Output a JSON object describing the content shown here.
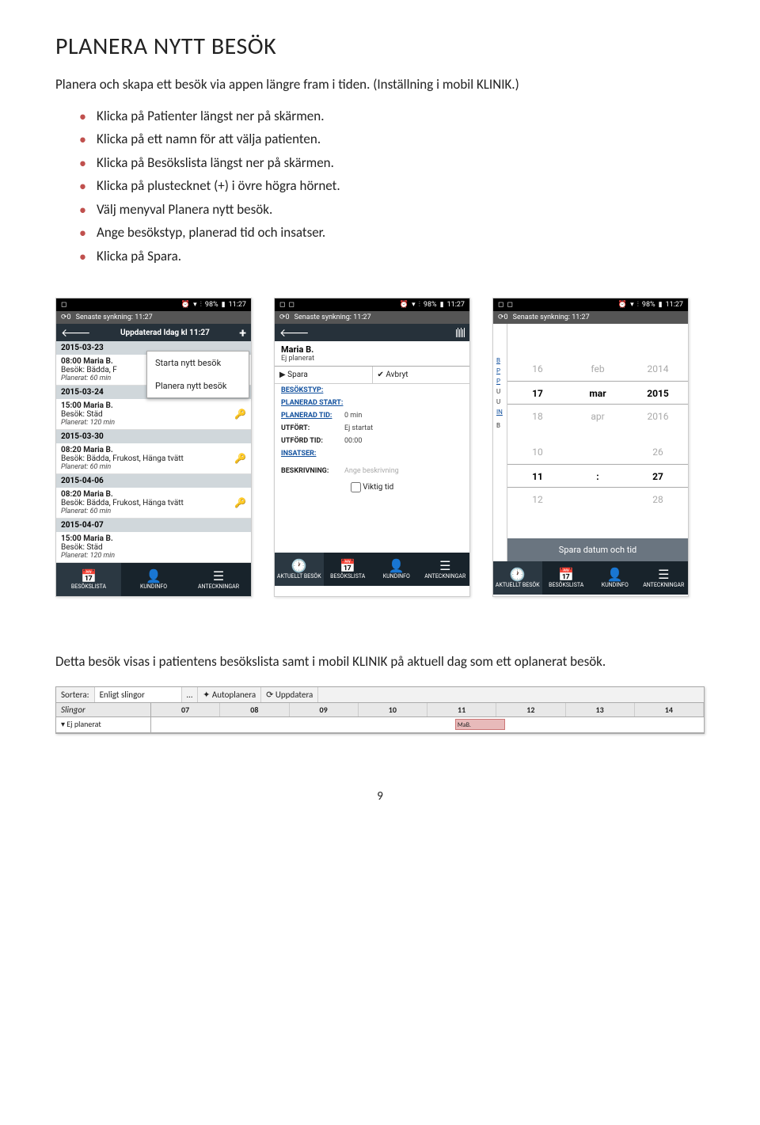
{
  "doc": {
    "heading": "PLANERA NYTT BESÖK",
    "intro": "Planera och skapa ett besök via appen längre fram i tiden. (Inställning i mobil KLINIK.)",
    "steps": [
      "Klicka på Patienter längst ner på skärmen.",
      "Klicka på ett namn för att välja patienten.",
      "Klicka på Besökslista längst ner på skärmen.",
      "Klicka på plustecknet (+) i övre högra hörnet.",
      "Välj menyval Planera nytt besök.",
      "Ange besökstyp, planerad tid och insatser.",
      "Klicka på Spara."
    ],
    "after": "Detta besök visas i patientens besökslista samt i mobil KLINIK på aktuell dag som ett oplanerat besök.",
    "pagenum": "9"
  },
  "status": {
    "battery": "98%",
    "time": "11:27"
  },
  "sync": {
    "count": "0",
    "label": "Senaste synkning: 11:27"
  },
  "phone1": {
    "topbar_title": "Uppdaterad Idag kl 11:27",
    "popup": [
      "Starta nytt besök",
      "Planera nytt besök"
    ],
    "entries": [
      {
        "date": "2015-03-23",
        "time": "08:00 Maria B.",
        "desc": "Besök: Bädda, F",
        "plan": "Planerat: 60 min"
      },
      {
        "date": "2015-03-24",
        "time": "15:00 Maria B.",
        "desc": "Besök: Städ",
        "plan": "Planerat: 120 min"
      },
      {
        "date": "2015-03-30",
        "time": "08:20 Maria B.",
        "desc": "Besök: Bädda, Frukost, Hänga tvätt",
        "plan": "Planerat: 60 min"
      },
      {
        "date": "2015-04-06",
        "time": "08:20 Maria B.",
        "desc": "Besök: Bädda, Frukost, Hänga tvätt",
        "plan": "Planerat: 60 min"
      },
      {
        "date": "2015-04-07",
        "time": "15:00 Maria B.",
        "desc": "Besök: Städ",
        "plan": "Planerat: 120 min"
      }
    ],
    "nav": [
      "BESÖKSLISTA",
      "KUNDINFO",
      "ANTECKNINGAR"
    ]
  },
  "phone2": {
    "name": "Maria B.",
    "sub": "Ej planerat",
    "save": "Spara",
    "cancel": "Avbryt",
    "rows": {
      "besokstyp": "BESÖKSTYP:",
      "planstart": "PLANERAD START:",
      "plantid_l": "PLANERAD TID:",
      "plantid_v": "0 min",
      "utfort_l": "UTFÖRT:",
      "utfort_v": "Ej startat",
      "utfordtid_l": "UTFÖRD TID:",
      "utfordtid_v": "00:00",
      "insatser": "INSATSER:",
      "beskr_l": "BESKRIVNING:",
      "beskr_v": "Ange beskrivning",
      "viktig": "Viktig tid"
    },
    "nav": [
      "AKTUELLT BESÖK",
      "BESÖKSLISTA",
      "KUNDINFO",
      "ANTECKNINGAR"
    ]
  },
  "phone3": {
    "picker": {
      "rows": [
        [
          "16",
          "feb",
          "2014"
        ],
        [
          "17",
          "mar",
          "2015"
        ],
        [
          "18",
          "apr",
          "2016"
        ],
        [
          "",
          ""
        ],
        [
          "10",
          "",
          "26"
        ],
        [
          "11",
          ":",
          "27"
        ],
        [
          "12",
          "",
          "28"
        ]
      ],
      "btn": "Spara datum och tid"
    },
    "peek": [
      "B",
      "P",
      "P",
      "U",
      "U",
      "IN",
      "",
      "B"
    ],
    "nav": [
      "AKTUELLT BESÖK",
      "BESÖKSLISTA",
      "KUNDINFO",
      "ANTECKNINGAR"
    ]
  },
  "gantt": {
    "sort_label": "Sortera:",
    "sort_value": "Enligt slingor",
    "btn_auto": "Autoplanera",
    "btn_upd": "Uppdatera",
    "col_slingor": "Slingor",
    "hours": [
      "07",
      "08",
      "09",
      "10",
      "11",
      "12",
      "13",
      "14"
    ],
    "row_label": "Ej planerat",
    "block": "MaB."
  }
}
